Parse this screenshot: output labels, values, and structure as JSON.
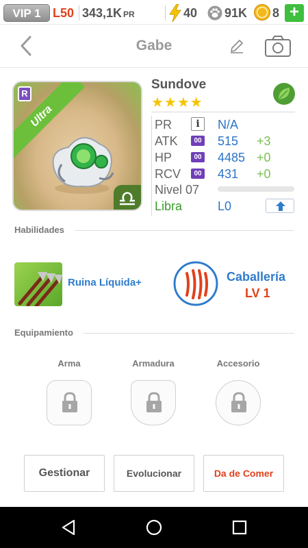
{
  "status": {
    "vip": "VIP 1",
    "level": "L50",
    "pr_value": "343,1K",
    "pr_label": "PR",
    "energy": "40",
    "paw": "91K",
    "coins": "8",
    "plus": "+"
  },
  "header": {
    "title": "Gabe",
    "back_icon": "chevron-left-icon",
    "edit_icon": "pencil-icon",
    "camera_icon": "camera-icon"
  },
  "monster": {
    "rank": "R",
    "rarity": "Ultra",
    "name": "Sundove",
    "stars": "★★★★",
    "element_icon": "leaf-icon",
    "zodiac_icon": "libra-icon",
    "stats": {
      "pr_label": "PR",
      "pr_info": "i",
      "pr_value": "N/A",
      "atk_label": "ATK",
      "atk_badge": "00",
      "atk_value": "515",
      "atk_bonus": "+3",
      "hp_label": "HP",
      "hp_badge": "00",
      "hp_value": "4485",
      "hp_bonus": "+0",
      "rcv_label": "RCV",
      "rcv_badge": "00",
      "rcv_value": "431",
      "rcv_bonus": "+0",
      "level_label": "Nivel 07",
      "level_progress": 0.0,
      "zodiac_label": "Libra",
      "zodiac_level": "L0"
    }
  },
  "skills": {
    "section_title": "Habilidades",
    "active_name": "Ruina Líquida+",
    "passive_name": "Caballería",
    "passive_level": "LV 1"
  },
  "equipment": {
    "section_title": "Equipamiento",
    "weapon": "Arma",
    "armor": "Armadura",
    "accessory": "Accesorio"
  },
  "actions": {
    "manage": "Gestionar",
    "evolve": "Evolucionar",
    "feed": "Da de Comer"
  },
  "colors": {
    "accent_blue": "#2f7ccc",
    "accent_red": "#e0411c",
    "green": "#3fbf3f",
    "star": "#f5c400"
  }
}
